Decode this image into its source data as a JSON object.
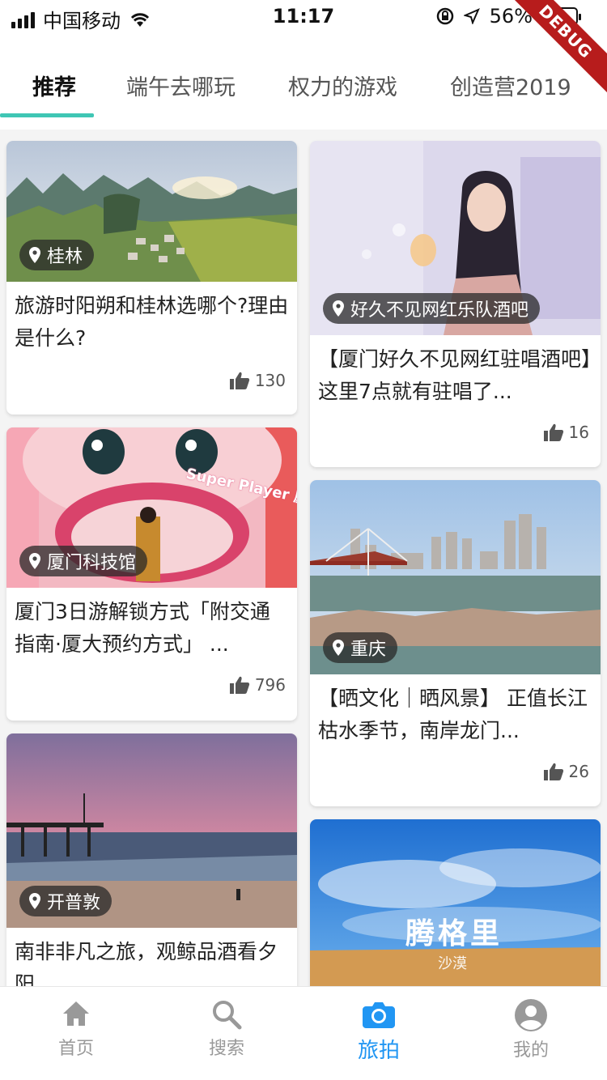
{
  "status_bar": {
    "carrier": "中国移动",
    "time": "11:17",
    "battery": "56%",
    "debug_label": "DEBUG"
  },
  "tabs": [
    {
      "label": "推荐",
      "active": true
    },
    {
      "label": "端午去哪玩"
    },
    {
      "label": "权力的游戏"
    },
    {
      "label": "创造营2019"
    }
  ],
  "cards": [
    {
      "location": "桂林",
      "title": "旅游时阳朔和桂林选哪个?理由是什么?",
      "likes": "130"
    },
    {
      "location": "好久不见网红乐队酒吧",
      "title": "【厦门好久不见网红驻唱酒吧】这里7点就有驻唱了...",
      "likes": "16"
    },
    {
      "location": "厦门科技馆",
      "title": "厦门3日游解锁方式「附交通指南·厦大预约方式」 ...",
      "likes": "796",
      "overlay_text": "Super Player 厦门科技馆"
    },
    {
      "location": "重庆",
      "title": "【晒文化｜晒风景】 正值长江枯水季节，南岸龙门...",
      "likes": "26"
    },
    {
      "location": "开普敦",
      "title": "南非非凡之旅，观鲸品酒看夕阳"
    },
    {
      "overlay_title": "腾格里",
      "overlay_sub": "沙漠"
    }
  ],
  "bottom_nav": [
    {
      "label": "首页",
      "icon": "home-icon"
    },
    {
      "label": "搜索",
      "icon": "search-icon"
    },
    {
      "label": "旅拍",
      "icon": "camera-icon",
      "active": true
    },
    {
      "label": "我的",
      "icon": "user-icon"
    }
  ],
  "colors": {
    "accent": "#3fc6b4",
    "nav_active": "#2196f3",
    "debug": "#b71c1c"
  }
}
